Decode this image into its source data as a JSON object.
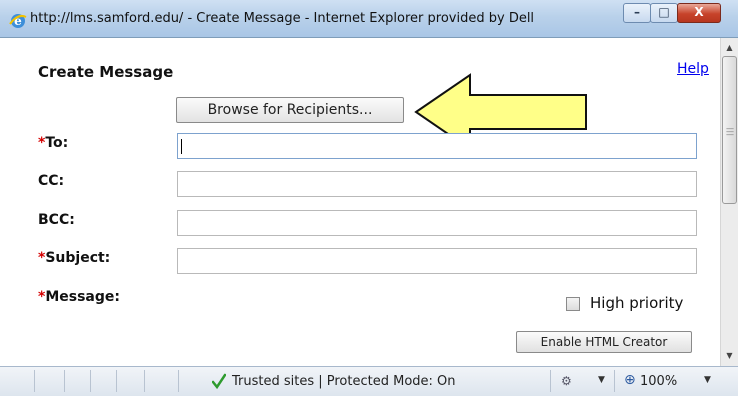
{
  "window": {
    "title": "http://lms.samford.edu/ - Create Message - Internet Explorer provided by Dell",
    "minimize_glyph": "–",
    "maximize_glyph": "□",
    "close_glyph": "X"
  },
  "page": {
    "heading": "Create Message",
    "help_link": "Help",
    "browse_button": "Browse for Recipients...",
    "fields": {
      "to": {
        "required": "*",
        "label": "To:",
        "value": ""
      },
      "cc": {
        "label": "CC:",
        "value": ""
      },
      "bcc": {
        "label": "BCC:",
        "value": ""
      },
      "subject": {
        "required": "*",
        "label": "Subject:",
        "value": ""
      },
      "message": {
        "required": "*",
        "label": "Message:"
      }
    },
    "high_priority_label": "High priority",
    "high_priority_checked": false,
    "html_creator_button": "Enable HTML Creator"
  },
  "statusbar": {
    "zone_text": "Trusted sites | Protected Mode: On",
    "zoom_text": "100%",
    "dropdown_glyph": "▼"
  },
  "icons": [
    "ie-icon",
    "callout-arrow-icon",
    "checkmark-icon",
    "zone-icon",
    "zoom-icon"
  ],
  "colors": {
    "required_marker": "#d40000",
    "link": "#0000ee",
    "arrow_fill": "#ffff88",
    "close_button": "#c7432a"
  }
}
